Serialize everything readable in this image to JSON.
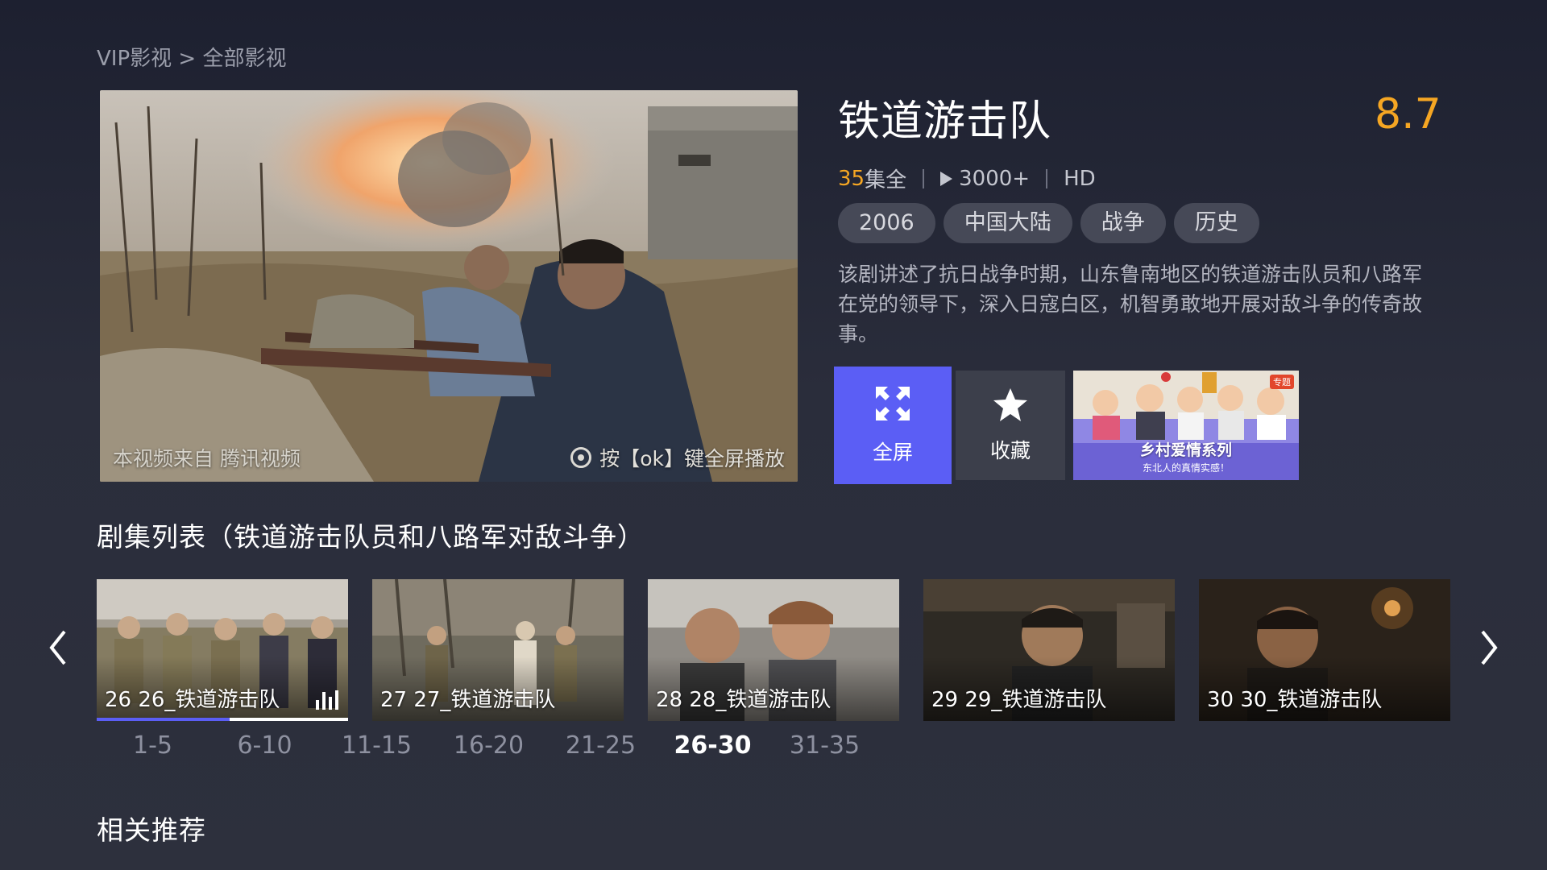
{
  "breadcrumb": "VIP影视 > 全部影视",
  "video": {
    "source_text": "本视频来自 腾讯视频",
    "hint_text": "按【ok】键全屏播放"
  },
  "show": {
    "title": "铁道游击队",
    "rating": "8.7",
    "episode_count": "35",
    "episode_suffix": "集全",
    "play_count": "3000+",
    "quality": "HD",
    "tags": [
      "2006",
      "中国大陆",
      "战争",
      "历史"
    ],
    "description": "该剧讲述了抗日战争时期，山东鲁南地区的铁道游击队员和八路军在党的领导下，深入日寇白区，机智勇敢地开展对敌斗争的传奇故事。"
  },
  "actions": {
    "fullscreen_label": "全屏",
    "favorite_label": "收藏"
  },
  "promo": {
    "title": "乡村爱情系列",
    "subtitle": "东北人的真情实感！",
    "badge": "专题"
  },
  "episodes": {
    "section_title": "剧集列表（铁道游击队员和八路军对敌斗争）",
    "items": [
      {
        "label": "26 26_铁道游击队",
        "playing": true,
        "progress": 0.53
      },
      {
        "label": "27 27_铁道游击队",
        "playing": false
      },
      {
        "label": "28 28_铁道游击队",
        "playing": false
      },
      {
        "label": "29 29_铁道游击队",
        "playing": false
      },
      {
        "label": "30 30_铁道游击队",
        "playing": false
      }
    ],
    "ranges": [
      "1-5",
      "6-10",
      "11-15",
      "16-20",
      "21-25",
      "26-30",
      "31-35"
    ],
    "active_range": "26-30"
  },
  "related_title": "相关推荐",
  "colors": {
    "accent_blue": "#5b5ef5",
    "rating_orange": "#f5a623",
    "background": "#2a2d3b"
  },
  "icons": [
    "fullscreen-icon",
    "star-icon",
    "play-icon",
    "remote-ok-icon",
    "chevron-left-icon",
    "chevron-right-icon",
    "playing-bars-icon"
  ]
}
